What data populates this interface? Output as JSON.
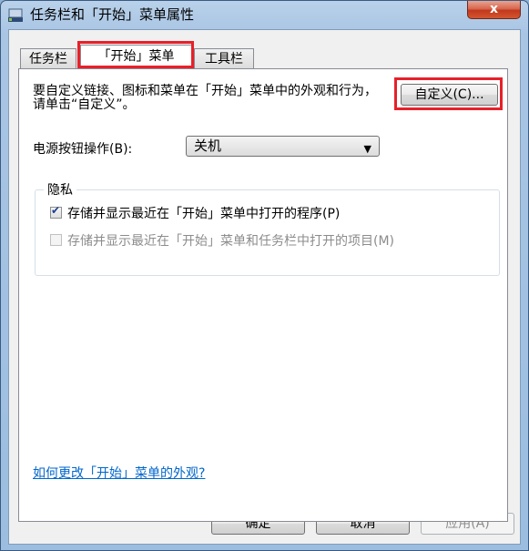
{
  "window": {
    "title": "任务栏和「开始」菜单属性",
    "close_label": "x"
  },
  "tabs": [
    {
      "label": "任务栏"
    },
    {
      "label": "「开始」菜单"
    },
    {
      "label": "工具栏"
    }
  ],
  "panel": {
    "description": "要自定义链接、图标和菜单在「开始」菜单中的外观和行为，请单击“自定义”。",
    "customize_label": "自定义(C)...",
    "power_label": "电源按钮操作(B):",
    "power_value": "关机",
    "privacy_title": "隐私",
    "privacy_options": [
      {
        "label": "存储并显示最近在「开始」菜单中打开的程序(P)",
        "checked": true
      },
      {
        "label": "存储并显示最近在「开始」菜单和任务栏中打开的项目(M)",
        "checked": false
      }
    ],
    "help_link": "如何更改「开始」菜单的外观?"
  },
  "footer": {
    "ok_label": "确定",
    "cancel_label": "取消",
    "apply_label": "应用(A)"
  }
}
